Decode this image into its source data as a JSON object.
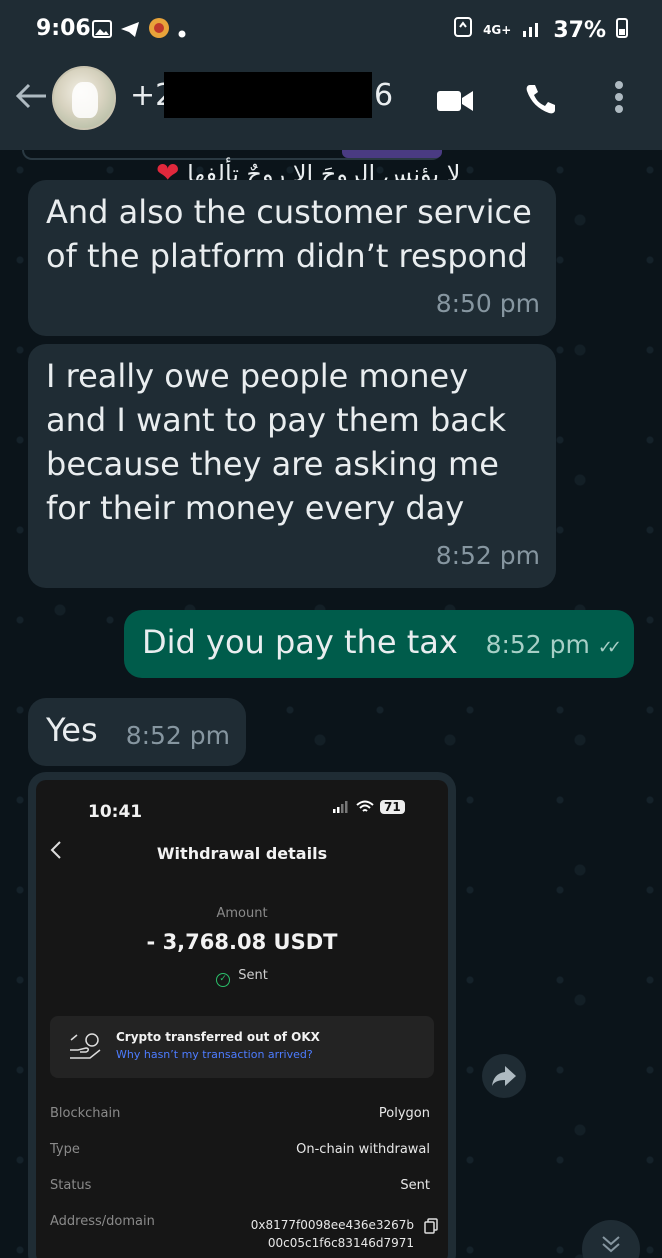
{
  "status_bar": {
    "time": "9:06",
    "network": "4G+",
    "battery": "37%"
  },
  "header": {
    "contact_prefix": "+2",
    "contact_suffix": "6"
  },
  "chat": {
    "partial_top": {
      "text": "لا يؤنس الروحَ إلا روحٌ تألفها",
      "heart": "❤"
    },
    "messages": [
      {
        "direction": "in",
        "text": "And also the customer service of the platform didn’t respond",
        "time": "8:50 pm"
      },
      {
        "direction": "in",
        "text": "I really owe people money and I want to pay them back because they are asking me for their money every day",
        "time": "8:52 pm"
      },
      {
        "direction": "out",
        "text": "Did you pay the tax",
        "time": "8:52 pm",
        "ticks": "✓✓"
      },
      {
        "direction": "in",
        "text": "Yes",
        "time": "8:52 pm"
      }
    ]
  },
  "shared_image": {
    "time": "10:41",
    "battery": "71",
    "title": "Withdrawal details",
    "amount_label": "Amount",
    "amount": "- 3,768.08 USDT",
    "status_short": "Sent",
    "card_title": "Crypto transferred out of OKX",
    "card_link": "Why hasn’t my transaction arrived?",
    "rows": [
      {
        "key": "Blockchain",
        "value": "Polygon"
      },
      {
        "key": "Type",
        "value": "On-chain withdrawal"
      },
      {
        "key": "Status",
        "value": "Sent"
      },
      {
        "key": "Address/domain",
        "value_line1": "0x8177f0098ee436e3267b",
        "value_line2": "00c05c1f6c83146d7971"
      }
    ]
  },
  "colors": {
    "incoming_bubble": "#1f2c34",
    "outgoing_bubble": "#005c4b",
    "chat_background": "#0b141a",
    "header_background": "#1f2c34",
    "link_blue": "#4d7cff",
    "sent_green": "#2bbf6a"
  },
  "icons": [
    "back-arrow-icon",
    "video-call-icon",
    "phone-call-icon",
    "more-options-icon",
    "forward-icon",
    "scroll-down-icon",
    "copy-icon",
    "read-receipt-icon"
  ]
}
